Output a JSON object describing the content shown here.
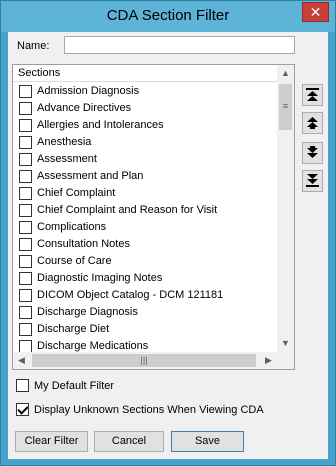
{
  "window": {
    "title": "CDA Section Filter",
    "close_glyph": "✕"
  },
  "name_field": {
    "label": "Name:",
    "value": ""
  },
  "sections": {
    "header": "Sections",
    "items": [
      "Admission Diagnosis",
      "Advance Directives",
      "Allergies and Intolerances",
      "Anesthesia",
      "Assessment",
      "Assessment and Plan",
      "Chief Complaint",
      "Chief Complaint and Reason for Visit",
      "Complications",
      "Consultation Notes",
      "Course of Care",
      "Diagnostic Imaging Notes",
      "DICOM Object Catalog - DCM 121181",
      "Discharge Diagnosis",
      "Discharge Diet",
      "Discharge Medications"
    ]
  },
  "move_buttons": [
    "move-to-top-icon",
    "move-up-icon",
    "move-down-icon",
    "move-to-bottom-icon"
  ],
  "options": {
    "default_filter": {
      "label": "My Default Filter",
      "checked": false
    },
    "display_unknown": {
      "label": "Display Unknown Sections When Viewing CDA",
      "checked": true
    }
  },
  "buttons": {
    "clear": "Clear Filter",
    "cancel": "Cancel",
    "save": "Save"
  }
}
